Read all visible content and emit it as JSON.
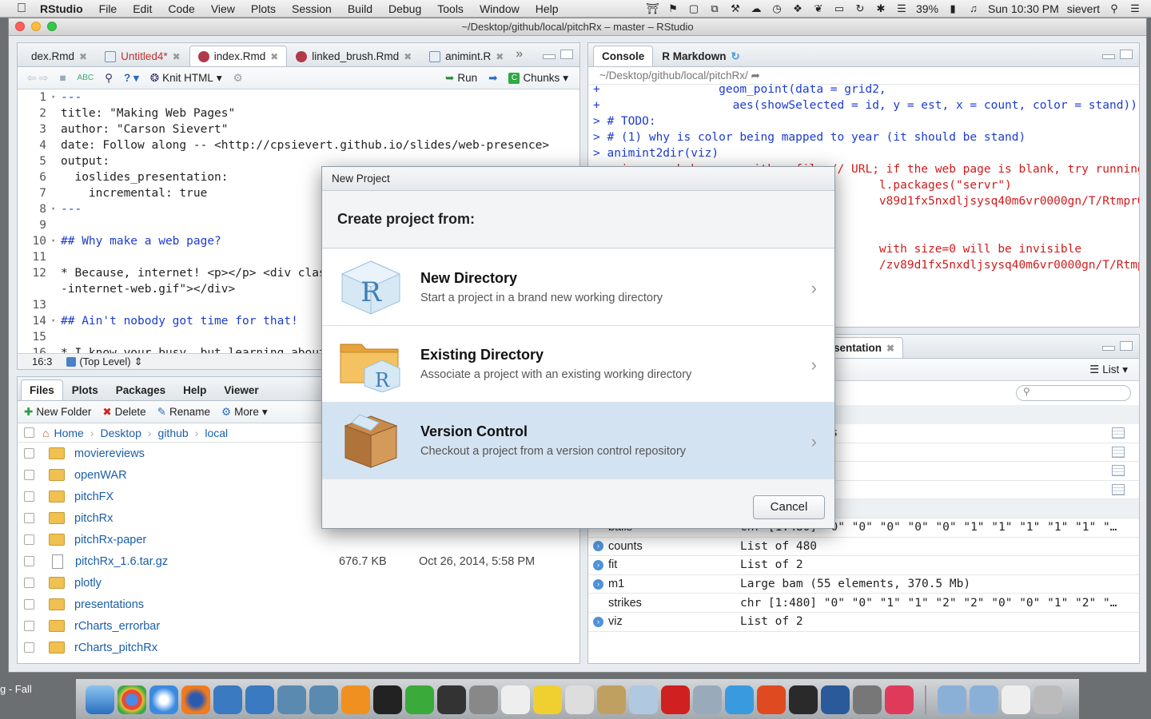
{
  "menubar": {
    "app": "RStudio",
    "items": [
      "File",
      "Edit",
      "Code",
      "View",
      "Plots",
      "Session",
      "Build",
      "Debug",
      "Tools",
      "Window",
      "Help"
    ],
    "battery": "39%",
    "clock": "Sun 10:30 PM",
    "user": "sievert"
  },
  "window": {
    "title": "~/Desktop/github/local/pitchRx – master – RStudio"
  },
  "editor": {
    "tabs": [
      {
        "label": "dex.Rmd",
        "active": false
      },
      {
        "label": "Untitled4*",
        "active": false,
        "modified": true
      },
      {
        "label": "index.Rmd",
        "active": true
      },
      {
        "label": "linked_brush.Rmd",
        "active": false
      },
      {
        "label": "animint.R",
        "active": false
      }
    ],
    "toolbar": {
      "knit": "Knit HTML",
      "run": "Run",
      "chunks": "Chunks"
    },
    "lines": [
      {
        "n": "1",
        "fold": "▾",
        "text": "---",
        "color": "#1c3bd1"
      },
      {
        "n": "2",
        "fold": "",
        "text": "title: \"Making Web Pages\"",
        "color": "#222"
      },
      {
        "n": "3",
        "fold": "",
        "text": "author: \"Carson Sievert\"",
        "color": "#222"
      },
      {
        "n": "4",
        "fold": "",
        "text": "date: Follow along -- <http://cpsievert.github.io/slides/web-presence>",
        "color": "#222"
      },
      {
        "n": "5",
        "fold": "",
        "text": "output:",
        "color": "#222"
      },
      {
        "n": "6",
        "fold": "",
        "text": "  ioslides_presentation:",
        "color": "#222"
      },
      {
        "n": "7",
        "fold": "",
        "text": "    incremental: true",
        "color": "#222"
      },
      {
        "n": "8",
        "fold": "▾",
        "text": "---",
        "color": "#1c3bd1"
      },
      {
        "n": "9",
        "fold": "",
        "text": "",
        "color": "#222"
      },
      {
        "n": "10",
        "fold": "▾",
        "text": "## Why make a web page?",
        "color": "#1c3bd1"
      },
      {
        "n": "11",
        "fold": "",
        "text": "",
        "color": "#222"
      },
      {
        "n": "12",
        "fold": "",
        "text": "* Because, internet! <p></p> <div class=",
        "color": "#222"
      },
      {
        "n": "",
        "fold": "",
        "text": "-internet-web.gif\"></div>",
        "color": "#222"
      },
      {
        "n": "13",
        "fold": "",
        "text": "",
        "color": "#222"
      },
      {
        "n": "14",
        "fold": "▾",
        "text": "## Ain't nobody got time for that!",
        "color": "#1c3bd1"
      },
      {
        "n": "15",
        "fold": "",
        "text": "",
        "color": "#222"
      },
      {
        "n": "16",
        "fold": "",
        "text": "* I know your busy, but learning about w",
        "color": "#222"
      }
    ],
    "status": {
      "pos": "16:3",
      "scope": "(Top Level)"
    }
  },
  "console": {
    "tabs": [
      "Console",
      "R Markdown"
    ],
    "path": "~/Desktop/github/local/pitchRx/",
    "lines": [
      {
        "text": "+                 geom_point(data = grid2,",
        "type": "in"
      },
      {
        "text": "+                   aes(showSelected = id, y = est, x = count, color = stand))",
        "type": "in"
      },
      {
        "text": "> # TODO:",
        "type": "in"
      },
      {
        "text": "> # (1) why is color being mapped to year (it should be stand)",
        "type": "in"
      },
      {
        "text": "> animint2dir(viz)",
        "type": "in"
      },
      {
        "text": "opening a web browser with a file:// URL; if the web page is blank, try running",
        "type": "err"
      },
      {
        "text": "                                         l.packages(\"servr\")",
        "type": "err"
      },
      {
        "text": "                                         v89d1fx5nxdljsysq40m6vr0000gn/T/RtmprOHJ6Z/file",
        "type": "err"
      },
      {
        "text": "",
        "type": "err"
      },
      {
        "text": "",
        "type": "err"
      },
      {
        "text": "                                         with size=0 will be invisible",
        "type": "err"
      },
      {
        "text": "                                         /zv89d1fx5nxdljsysq40m6vr0000gn/T/RtmprOHJ6Z/fi",
        "type": "err"
      }
    ]
  },
  "environment": {
    "tab": "sentation",
    "list_label": "List",
    "rows": [
      {
        "name": "",
        "value": "f 10 variables",
        "blue": false,
        "grid": true
      },
      {
        "name": "",
        "value": " variables",
        "blue": false,
        "grid": true
      },
      {
        "name": "",
        "value": "variables",
        "blue": false,
        "grid": true
      },
      {
        "name": "",
        "value": "variables",
        "blue": false,
        "grid": true
      },
      {
        "name": "",
        "value": "",
        "blue": false,
        "grid": false
      },
      {
        "name": "balls",
        "value": "chr [1:480] \"0\" \"0\" \"0\" \"0\" \"0\" \"1\" \"1\" \"1\" \"1\" \"1\" \"…",
        "blue": false,
        "grid": false
      },
      {
        "name": "counts",
        "value": "List of 480",
        "blue": true,
        "grid": false
      },
      {
        "name": "fit",
        "value": "List of 2",
        "blue": true,
        "grid": false
      },
      {
        "name": "m1",
        "value": "Large bam (55 elements, 370.5 Mb)",
        "blue": true,
        "grid": false
      },
      {
        "name": "strikes",
        "value": "chr [1:480] \"0\" \"0\" \"1\" \"1\" \"2\" \"2\" \"0\" \"0\" \"1\" \"2\" \"…",
        "blue": false,
        "grid": false
      },
      {
        "name": "viz",
        "value": "List of 2",
        "blue": true,
        "grid": false
      }
    ]
  },
  "files": {
    "tabs": [
      "Files",
      "Plots",
      "Packages",
      "Help",
      "Viewer"
    ],
    "toolbar": {
      "new_folder": "New Folder",
      "delete": "Delete",
      "rename": "Rename",
      "more": "More"
    },
    "breadcrumb": [
      "Home",
      "Desktop",
      "github",
      "local"
    ],
    "rows": [
      {
        "name": "moviereviews",
        "type": "folder",
        "size": "",
        "modified": ""
      },
      {
        "name": "openWAR",
        "type": "folder",
        "size": "",
        "modified": ""
      },
      {
        "name": "pitchFX",
        "type": "folder",
        "size": "",
        "modified": ""
      },
      {
        "name": "pitchRx",
        "type": "folder",
        "size": "",
        "modified": ""
      },
      {
        "name": "pitchRx-paper",
        "type": "folder",
        "size": "",
        "modified": ""
      },
      {
        "name": "pitchRx_1.6.tar.gz",
        "type": "file",
        "size": "676.7 KB",
        "modified": "Oct 26, 2014, 5:58 PM"
      },
      {
        "name": "plotly",
        "type": "folder",
        "size": "",
        "modified": ""
      },
      {
        "name": "presentations",
        "type": "folder",
        "size": "",
        "modified": ""
      },
      {
        "name": "rCharts_errorbar",
        "type": "folder",
        "size": "",
        "modified": ""
      },
      {
        "name": "rCharts_pitchRx",
        "type": "folder",
        "size": "",
        "modified": ""
      }
    ]
  },
  "dialog": {
    "title": "New Project",
    "heading": "Create project from:",
    "options": [
      {
        "title": "New Directory",
        "desc": "Start a project in a brand new working directory",
        "selected": false,
        "icon": "r-cube-icon"
      },
      {
        "title": "Existing Directory",
        "desc": "Associate a project with an existing working directory",
        "selected": false,
        "icon": "folder-r-icon"
      },
      {
        "title": "Version Control",
        "desc": "Checkout a project from a version control repository",
        "selected": true,
        "icon": "box-icon"
      }
    ],
    "cancel": "Cancel"
  },
  "desktop": {
    "label": "g - Fall"
  }
}
